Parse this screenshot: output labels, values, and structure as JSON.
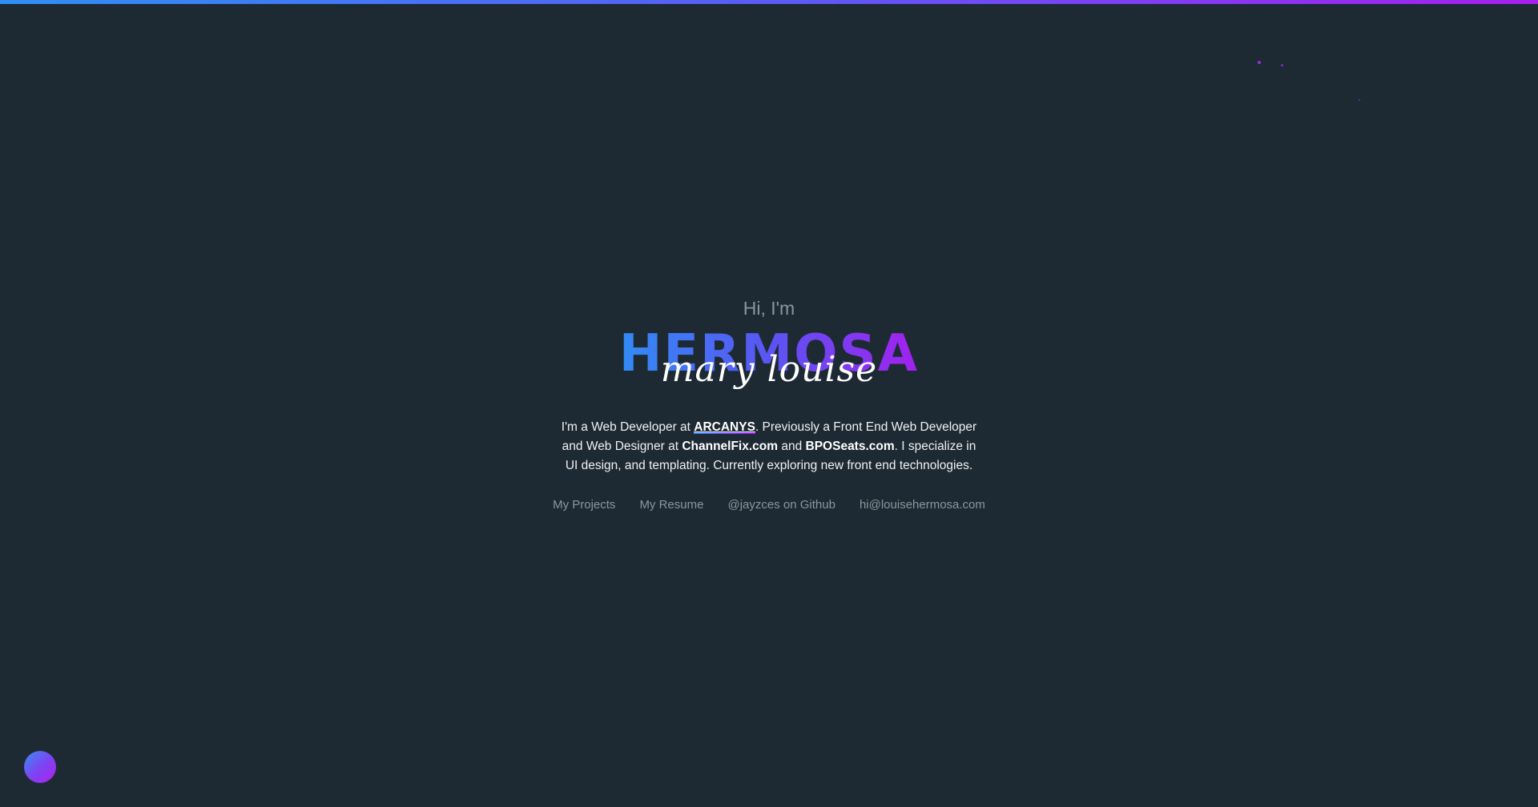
{
  "theme": {
    "background": "#1e2a33",
    "gradient_start": "#2f8ff5",
    "gradient_end": "#a71df0",
    "muted_text": "#8b959c"
  },
  "hero": {
    "greeting": "Hi, I'm",
    "surname": "HERMOSA",
    "firstname": "mary louise",
    "bio": {
      "part1": "I'm a Web Developer at ",
      "company": "ARCANYS",
      "part2": ". Previously a Front End Web Developer and Web Designer at ",
      "previous_company_1": "ChannelFix.com",
      "part3": " and ",
      "previous_company_2": "BPOSeats.com",
      "part4": ". I specialize in UI design, and templating. Currently exploring new front end technologies."
    }
  },
  "links": {
    "projects": "My Projects",
    "resume": "My Resume",
    "github": "@jayzces on Github",
    "email": "hi@louisehermosa.com"
  },
  "theme_toggle": {
    "icon": "gradient-circle-icon"
  }
}
